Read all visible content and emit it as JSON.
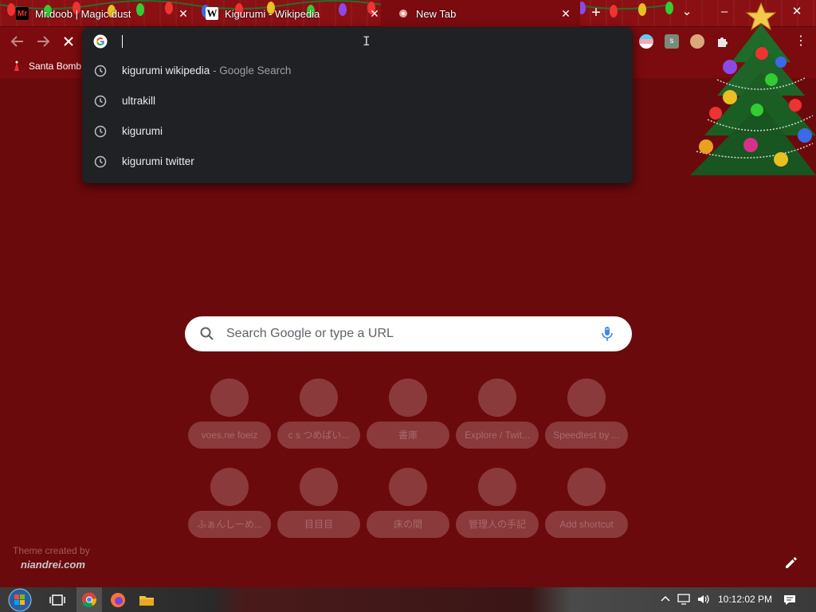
{
  "tabs": [
    {
      "label": "Mr.doob | Magic dust",
      "favicon": "mrdoob-favicon",
      "active": false
    },
    {
      "label": "Kigurumi - Wikipedia",
      "favicon": "wikipedia-favicon",
      "active": false
    },
    {
      "label": "New Tab",
      "favicon": "newtab-favicon",
      "active": true
    }
  ],
  "tab_close_glyph": "✕",
  "new_tab_glyph": "+",
  "window": {
    "dropdown": "⌄",
    "minimize": "–",
    "close": "✕"
  },
  "bookmarks": [
    {
      "label": "Santa Bomb"
    }
  ],
  "omnibox": {
    "value": "",
    "suggestions": [
      {
        "text": "kigurumi wikipedia",
        "suffix": " - Google Search"
      },
      {
        "text": "ultrakill",
        "suffix": ""
      },
      {
        "text": "kigurumi",
        "suffix": ""
      },
      {
        "text": "kigurumi twitter",
        "suffix": ""
      }
    ]
  },
  "ntp": {
    "search_placeholder": "Search Google or type a URL",
    "shortcuts": [
      {
        "label": "voes.ne foeiz"
      },
      {
        "label": "c s つめばい..."
      },
      {
        "label": "書庫"
      },
      {
        "label": "Explore / Twit..."
      },
      {
        "label": "Speedtest by ..."
      },
      {
        "label": "ふぁんしーめ..."
      },
      {
        "label": "目目目"
      },
      {
        "label": "床の間"
      },
      {
        "label": "管理人の手記"
      },
      {
        "label": "Add shortcut"
      }
    ],
    "theme_credit": "Theme created by",
    "theme_author": "niandrei.com"
  },
  "taskbar": {
    "time": "10:12:02 PM"
  },
  "colors": {
    "background": "#6b0a0c",
    "omnibox": "#202124",
    "accent": "#8a1014"
  }
}
